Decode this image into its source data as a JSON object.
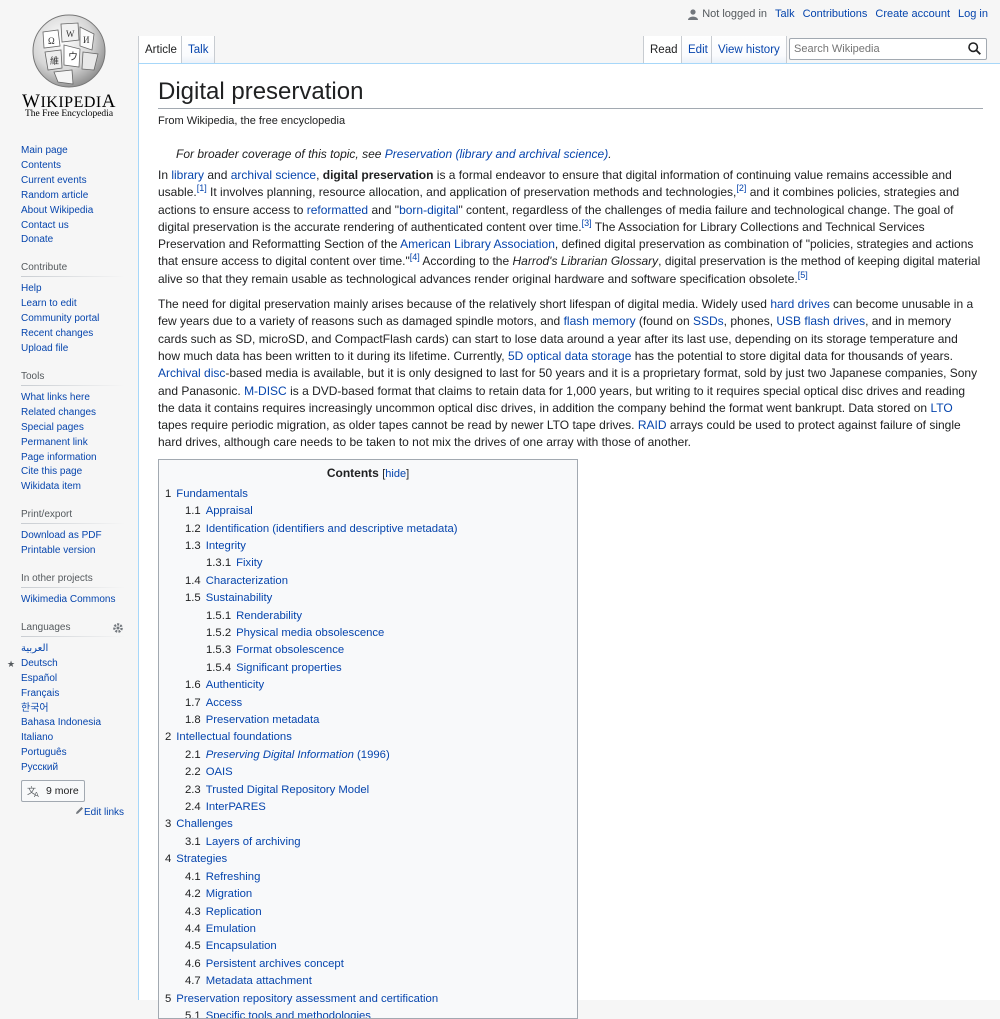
{
  "logo": {
    "wordmark": "Wikipedia",
    "tagline": "The Free Encyclopedia"
  },
  "personal": {
    "not_logged_in": "Not logged in",
    "talk": "Talk",
    "contributions": "Contributions",
    "create_account": "Create account",
    "log_in": "Log in"
  },
  "tabs": {
    "article": "Article",
    "talk": "Talk",
    "read": "Read",
    "edit": "Edit",
    "history": "View history"
  },
  "search": {
    "placeholder": "Search Wikipedia"
  },
  "sidebar": {
    "navigation": [
      "Main page",
      "Contents",
      "Current events",
      "Random article",
      "About Wikipedia",
      "Contact us",
      "Donate"
    ],
    "contribute": {
      "heading": "Contribute",
      "items": [
        "Help",
        "Learn to edit",
        "Community portal",
        "Recent changes",
        "Upload file"
      ]
    },
    "tools": {
      "heading": "Tools",
      "items": [
        "What links here",
        "Related changes",
        "Special pages",
        "Permanent link",
        "Page information",
        "Cite this page",
        "Wikidata item"
      ]
    },
    "print": {
      "heading": "Print/export",
      "items": [
        "Download as PDF",
        "Printable version"
      ]
    },
    "projects": {
      "heading": "In other projects",
      "items": [
        "Wikimedia Commons"
      ]
    },
    "languages": {
      "heading": "Languages",
      "items": [
        "العربية",
        "Deutsch",
        "Español",
        "Français",
        "한국어",
        "Bahasa Indonesia",
        "Italiano",
        "Português",
        "Русский"
      ],
      "more": "9 more",
      "edit_links": "Edit links"
    }
  },
  "article": {
    "title": "Digital preservation",
    "site_sub": "From Wikipedia, the free encyclopedia",
    "hatnote": {
      "prefix": "For broader coverage of this topic, see ",
      "link": "Preservation (library and archival science)",
      "suffix": "."
    },
    "p1": {
      "t1": "In ",
      "l1": "library",
      "t2": " and ",
      "l2": "archival science",
      "t3": ", ",
      "b1": "digital preservation",
      "t4": " is a formal endeavor to ensure that digital information of continuing value remains accessible and usable.",
      "r1": "[1]",
      "t5": " It involves planning, resource allocation, and application of preservation methods and technologies,",
      "r2": "[2]",
      "t6": " and it combines policies, strategies and actions to ensure access to ",
      "l3": "reformatted",
      "t7": " and \"",
      "l4": "born-digital",
      "t8": "\" content, regardless of the challenges of media failure and technological change. The goal of digital preservation is the accurate rendering of authenticated content over time.",
      "r3": "[3]",
      "t9": " The Association for Library Collections and Technical Services Preservation and Reformatting Section of the ",
      "l5": "American Library Association",
      "t10": ", defined digital preservation as combination of \"policies, strategies and actions that ensure access to digital content over time.\"",
      "r4": "[4]",
      "t11": " According to the ",
      "i1": "Harrod's Librarian Glossary",
      "t12": ", digital preservation is the method of keeping digital material alive so that they remain usable as technological advances render original hardware and software specification obsolete.",
      "r5": "[5]"
    },
    "p2": {
      "t1": "The need for digital preservation mainly arises because of the relatively short lifespan of digital media. Widely used ",
      "l1": "hard drives",
      "t2": " can become unusable in a few years due to a variety of reasons such as damaged spindle motors, and ",
      "l2": "flash memory",
      "t3": " (found on ",
      "l3": "SSDs",
      "t4": ", phones, ",
      "l4": "USB flash drives",
      "t5": ", and in memory cards such as SD, microSD, and CompactFlash cards) can start to lose data around a year after its last use, depending on its storage temperature and how much data has been written to it during its lifetime. Currently, ",
      "l5": "5D optical data storage",
      "t6": " has the potential to store digital data for thousands of years. ",
      "l6": "Archival disc",
      "t7": "-based media is available, but it is only designed to last for 50 years and it is a proprietary format, sold by just two Japanese companies, Sony and Panasonic. ",
      "l7": "M-DISC",
      "t8": " is a DVD-based format that claims to retain data for 1,000 years, but writing to it requires special optical disc drives and reading the data it contains requires increasingly uncommon optical disc drives, in addition the company behind the format went bankrupt. Data stored on ",
      "l8": "LTO",
      "t9": " tapes require periodic migration, as older tapes cannot be read by newer LTO tape drives. ",
      "l9": "RAID",
      "t10": " arrays could be used to protect against failure of single hard drives, although care needs to be taken to not mix the drives of one array with those of another."
    }
  },
  "toc": {
    "title": "Contents",
    "toggle": "hide",
    "bracket_open": "[",
    "bracket_close": "]",
    "items": [
      {
        "num": "1",
        "text": "Fundamentals",
        "level": 1
      },
      {
        "num": "1.1",
        "text": "Appraisal",
        "level": 2
      },
      {
        "num": "1.2",
        "text": "Identification (identifiers and descriptive metadata)",
        "level": 2
      },
      {
        "num": "1.3",
        "text": "Integrity",
        "level": 2
      },
      {
        "num": "1.3.1",
        "text": "Fixity",
        "level": 3
      },
      {
        "num": "1.4",
        "text": "Characterization",
        "level": 2
      },
      {
        "num": "1.5",
        "text": "Sustainability",
        "level": 2
      },
      {
        "num": "1.5.1",
        "text": "Renderability",
        "level": 3
      },
      {
        "num": "1.5.2",
        "text": "Physical media obsolescence",
        "level": 3
      },
      {
        "num": "1.5.3",
        "text": "Format obsolescence",
        "level": 3
      },
      {
        "num": "1.5.4",
        "text": "Significant properties",
        "level": 3
      },
      {
        "num": "1.6",
        "text": "Authenticity",
        "level": 2
      },
      {
        "num": "1.7",
        "text": "Access",
        "level": 2
      },
      {
        "num": "1.8",
        "text": "Preservation metadata",
        "level": 2
      },
      {
        "num": "2",
        "text": "Intellectual foundations",
        "level": 1
      },
      {
        "num": "2.1",
        "text": "Preserving Digital Information",
        "suffix": " (1996)",
        "level": 2,
        "italic": true
      },
      {
        "num": "2.2",
        "text": "OAIS",
        "level": 2
      },
      {
        "num": "2.3",
        "text": "Trusted Digital Repository Model",
        "level": 2
      },
      {
        "num": "2.4",
        "text": "InterPARES",
        "level": 2
      },
      {
        "num": "3",
        "text": "Challenges",
        "level": 1
      },
      {
        "num": "3.1",
        "text": "Layers of archiving",
        "level": 2
      },
      {
        "num": "4",
        "text": "Strategies",
        "level": 1
      },
      {
        "num": "4.1",
        "text": "Refreshing",
        "level": 2
      },
      {
        "num": "4.2",
        "text": "Migration",
        "level": 2
      },
      {
        "num": "4.3",
        "text": "Replication",
        "level": 2
      },
      {
        "num": "4.4",
        "text": "Emulation",
        "level": 2
      },
      {
        "num": "4.5",
        "text": "Encapsulation",
        "level": 2
      },
      {
        "num": "4.6",
        "text": "Persistent archives concept",
        "level": 2
      },
      {
        "num": "4.7",
        "text": "Metadata attachment",
        "level": 2
      },
      {
        "num": "5",
        "text": "Preservation repository assessment and certification",
        "level": 1
      },
      {
        "num": "5.1",
        "text": "Specific tools and methodologies",
        "level": 2
      }
    ]
  }
}
